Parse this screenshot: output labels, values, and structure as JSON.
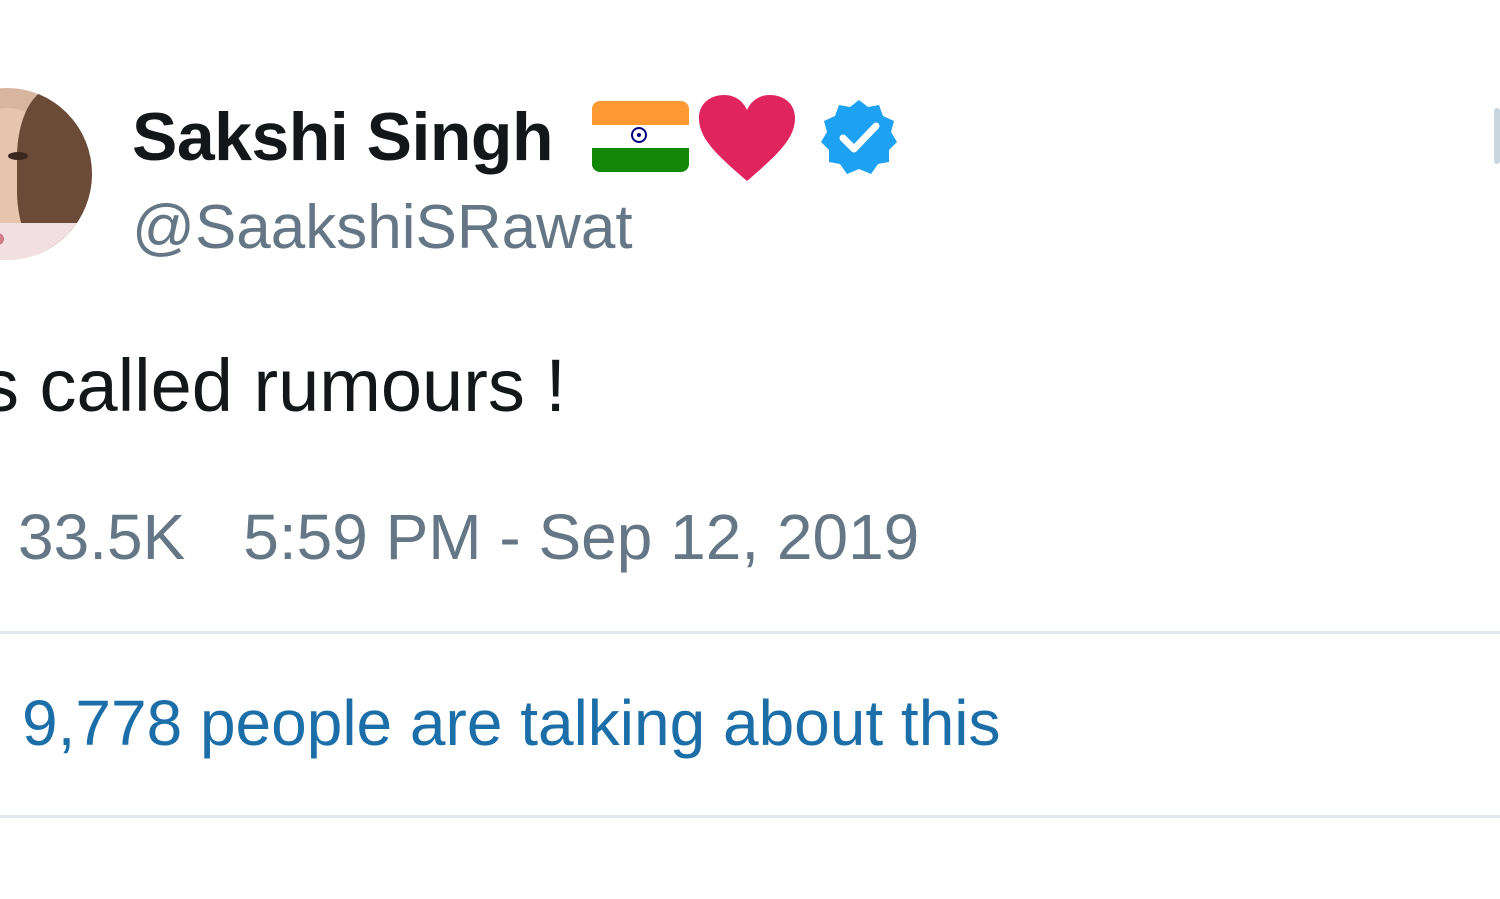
{
  "tweet": {
    "display_name": "Sakshi Singh",
    "handle": "@SaakshiSRawat",
    "text": "s called rumours !",
    "likes_count": "33.5K",
    "timestamp": "5:59 PM - Sep 12, 2019",
    "talking_about": "9,778 people are talking about this",
    "name_emoji": [
      "india-flag-icon",
      "red-heart-icon"
    ],
    "verified": true
  },
  "colors": {
    "name": "#14171a",
    "secondary": "#657786",
    "link": "#1b6ea8",
    "verified": "#1da1f2",
    "heart": "#e0245e",
    "divider": "#e1e8ed"
  }
}
